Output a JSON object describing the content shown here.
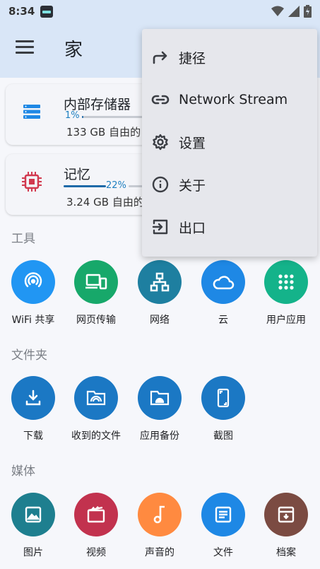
{
  "status": {
    "time": "8:34"
  },
  "appbar": {
    "title": "家"
  },
  "storage": [
    {
      "name": "内部存储器",
      "percent_text": "1%",
      "percent": 0.01,
      "free": "133 GB 自由的"
    },
    {
      "name": "记忆",
      "percent_text": "22%",
      "percent": 0.22,
      "free": "3.24 GB 自由的"
    }
  ],
  "sections": {
    "tools": "工具",
    "folders": "文件夹",
    "media": "媒体"
  },
  "tools": [
    {
      "label": "WiFi 共享",
      "icon": "wifi-share-icon",
      "color": "#2196f3"
    },
    {
      "label": "网页传输",
      "icon": "devices-icon",
      "color": "#17a86a"
    },
    {
      "label": "网络",
      "icon": "network-icon",
      "color": "#1e7fa0"
    },
    {
      "label": "云",
      "icon": "cloud-icon",
      "color": "#1e88e5"
    },
    {
      "label": "用户应用",
      "icon": "apps-grid-icon",
      "color": "#14b38a"
    }
  ],
  "folders": [
    {
      "label": "下载",
      "icon": "download-icon",
      "color": "#1b78c4"
    },
    {
      "label": "收到的文件",
      "icon": "received-files-icon",
      "color": "#1b78c4"
    },
    {
      "label": "应用备份",
      "icon": "android-folder-icon",
      "color": "#1b78c4"
    },
    {
      "label": "截图",
      "icon": "screenshot-icon",
      "color": "#1b78c4"
    }
  ],
  "media": [
    {
      "label": "图片",
      "icon": "image-icon",
      "color": "#1e7f8f"
    },
    {
      "label": "视频",
      "icon": "video-icon",
      "color": "#c2324e"
    },
    {
      "label": "声音的",
      "icon": "music-icon",
      "color": "#ff8a40"
    },
    {
      "label": "文件",
      "icon": "document-icon",
      "color": "#1e88e5"
    },
    {
      "label": "档案",
      "icon": "archive-icon",
      "color": "#7b4b42"
    }
  ],
  "menu": [
    {
      "label": "捷径",
      "icon": "shortcut-arrow-icon"
    },
    {
      "label": "Network Stream",
      "icon": "link-icon"
    },
    {
      "label": "设置",
      "icon": "gear-icon"
    },
    {
      "label": "关于",
      "icon": "info-icon"
    },
    {
      "label": "出口",
      "icon": "exit-icon"
    }
  ]
}
